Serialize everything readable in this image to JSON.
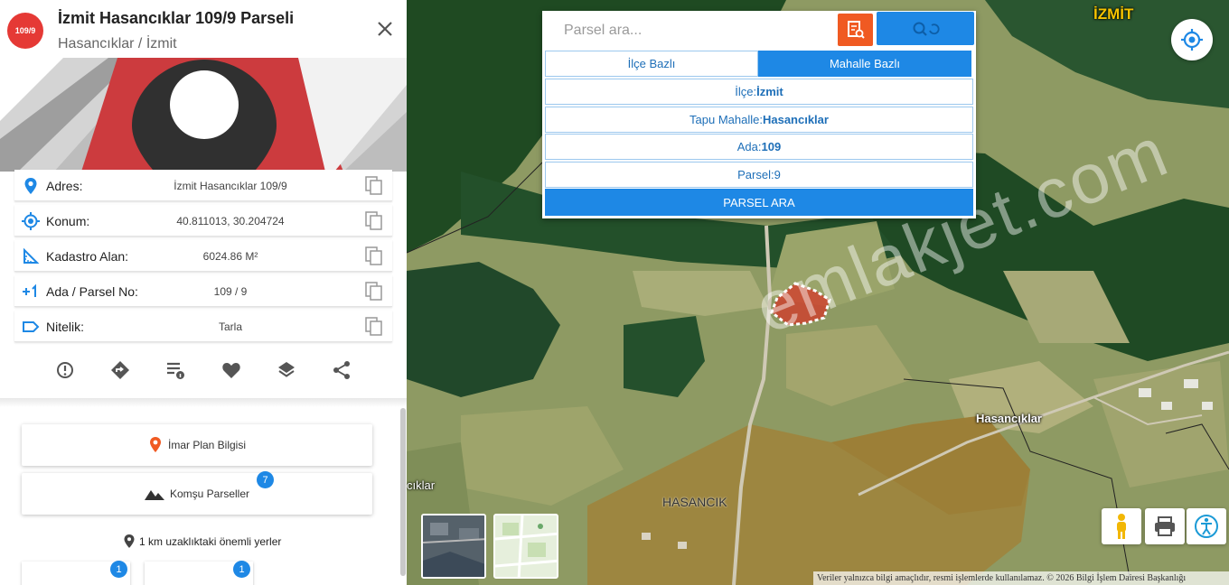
{
  "panel": {
    "badge": "109/9",
    "title": "İzmit Hasancıklar 109/9 Parseli",
    "subtitle": "Hasancıklar / İzmit",
    "info_rows": [
      {
        "label": "Adres:",
        "value": "İzmit Hasancıklar 109/9",
        "icon": "location-pin-icon"
      },
      {
        "label": "Konum:",
        "value": "40.811013, 30.204724",
        "icon": "crosshair-icon"
      },
      {
        "label": "Kadastro Alan:",
        "value": "6024.86 M²",
        "icon": "area-ruler-icon"
      },
      {
        "label": "Ada / Parsel No:",
        "value": "109 / 9",
        "icon": "plus-one-icon"
      },
      {
        "label": "Nitelik:",
        "value": "Tarla",
        "icon": "tag-icon"
      }
    ],
    "actions": [
      "report-icon",
      "directions-icon",
      "list-info-icon",
      "favorite-icon",
      "layers-icon",
      "share-icon"
    ],
    "imar_button": "İmar Plan Bilgisi",
    "komsu_button": "Komşu Parseller",
    "komsu_count": "7",
    "nearby_title": "1 km uzaklıktaki önemli yerler",
    "nearby_counts": [
      "1",
      "1"
    ]
  },
  "search": {
    "placeholder": "Parsel ara...",
    "tabs": [
      "İlçe Bazlı",
      "Mahalle Bazlı"
    ],
    "active_tab": "Mahalle Bazlı",
    "fields": [
      {
        "label": "İlçe:",
        "value": "İzmit"
      },
      {
        "label": "Tapu Mahalle:",
        "value": "Hasancıklar"
      },
      {
        "label": "Ada:",
        "value": "109"
      },
      {
        "label": "Parsel:",
        "value": "9"
      }
    ],
    "submit": "PARSEL ARA"
  },
  "map": {
    "labels": [
      "İZMİT",
      "Hasancıklar",
      "HASANCIK",
      "cıklar"
    ],
    "watermark": "emlakjet.com",
    "footer": "Veriler yalnızca bilgi amaçlıdır, resmi işlemlerde kullanılamaz. © 2026 Bilgi İşlem Dairesi Başkanlığı"
  },
  "colors": {
    "accent_blue": "#1e88e5",
    "orange": "#f05a22",
    "badge_red": "#e53935",
    "parcel_red": "#d93025"
  }
}
